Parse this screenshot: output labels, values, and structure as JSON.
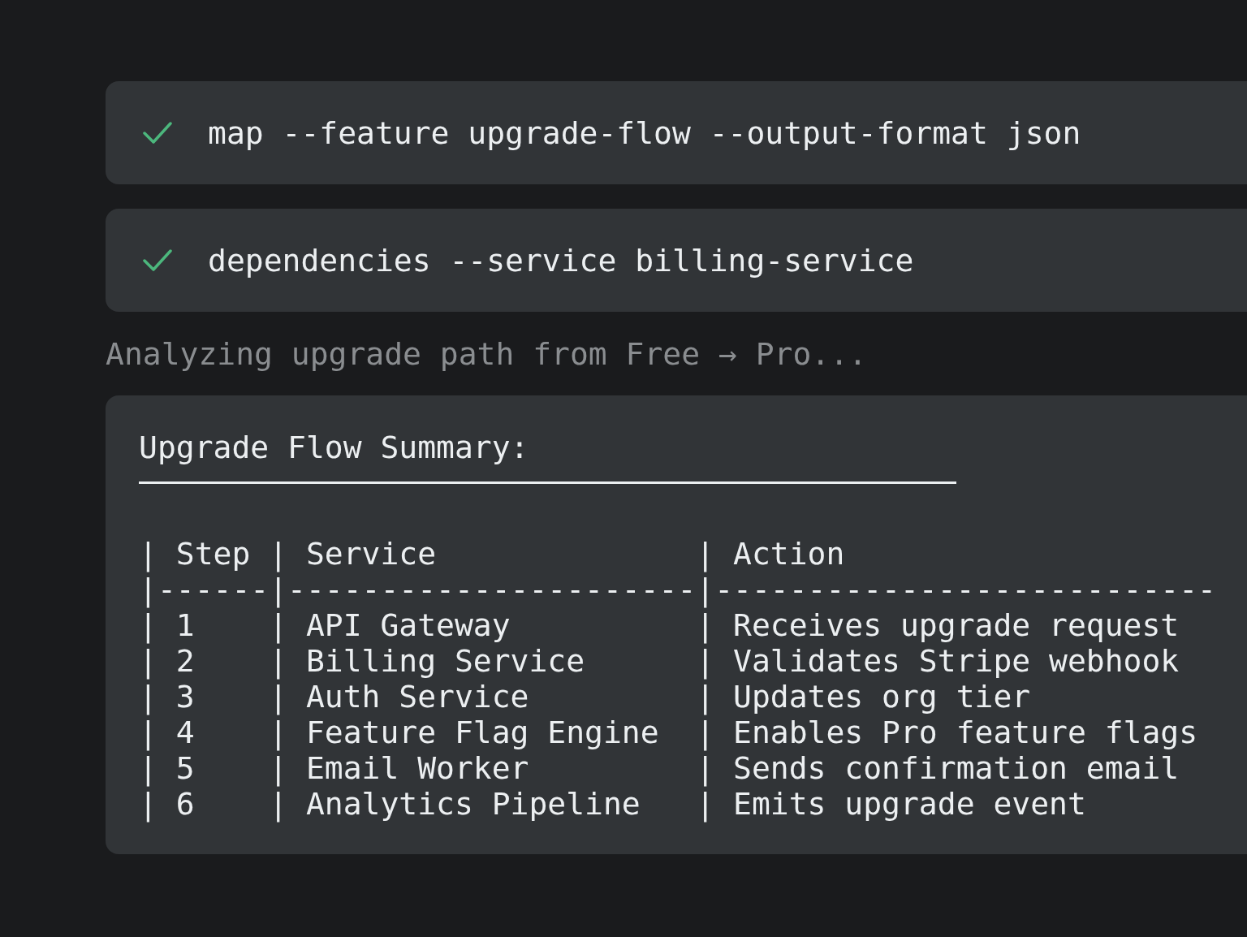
{
  "commands": [
    {
      "done": true,
      "text": "map --feature upgrade-flow --output-format json"
    },
    {
      "done": true,
      "text": "dependencies --service billing-service"
    }
  ],
  "progress_message": "Analyzing upgrade path from Free → Pro...",
  "summary": {
    "title": "Upgrade Flow Summary:",
    "table_lines": [
      "| Step | Service              | Action",
      "|------|----------------------|---------------------------",
      "| 1    | API Gateway          | Receives upgrade request",
      "| 2    | Billing Service      | Validates Stripe webhook",
      "| 3    | Auth Service         | Updates org tier",
      "| 4    | Feature Flag Engine  | Enables Pro feature flags",
      "| 5    | Email Worker         | Sends confirmation email",
      "| 6    | Analytics Pipeline   | Emits upgrade event"
    ]
  }
}
